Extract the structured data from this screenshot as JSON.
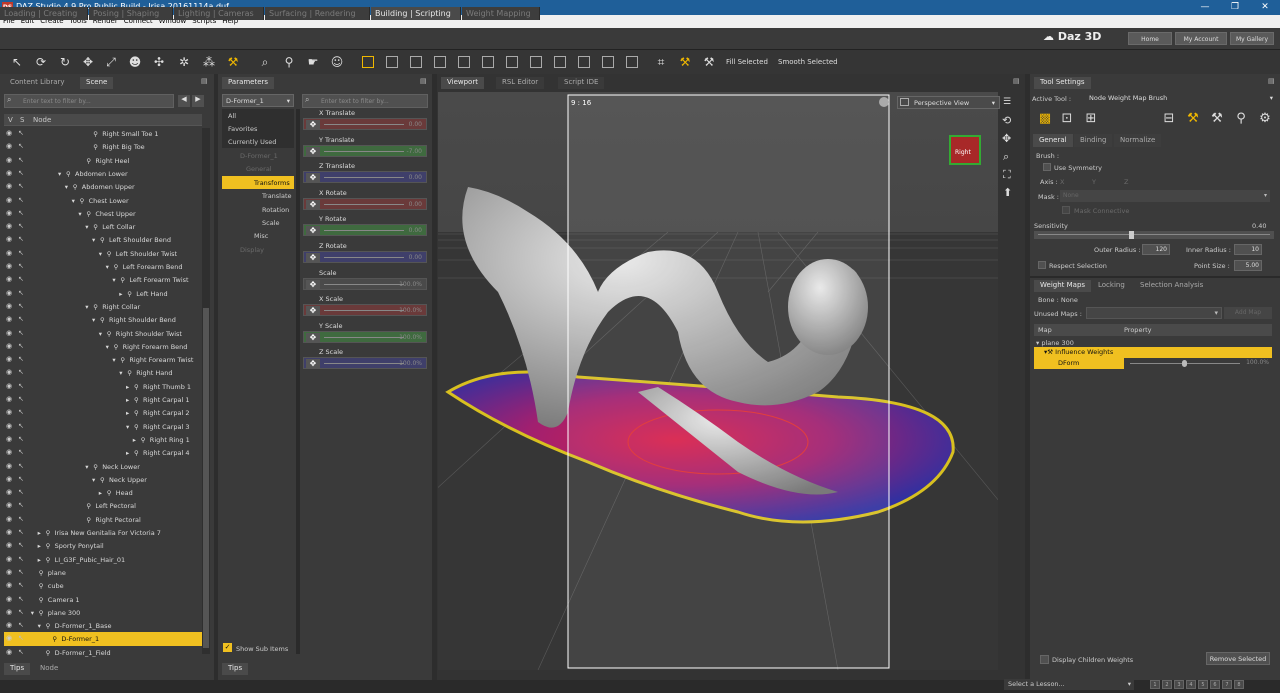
{
  "window": {
    "title": "DAZ Studio 4.9 Pro Public Build - Irisa 20161114a.duf",
    "icon": "DS",
    "min": "—",
    "max": "❐",
    "close": "✕"
  },
  "menu": [
    "File",
    "Edit",
    "Create",
    "Tools",
    "Render",
    "Connect",
    "Window",
    "Scripts",
    "Help"
  ],
  "rooms": [
    "Loading | Creating",
    "Posing | Shaping",
    "Lighting | Cameras",
    "Surfacing | Rendering",
    "Building | Scripting",
    "Weight Mapping"
  ],
  "brand": "Daz 3D",
  "top_buttons": [
    "Home",
    "My Account",
    "My Gallery"
  ],
  "toolbar": {
    "fill_selected": "Fill Selected",
    "smooth_selected": "Smooth Selected"
  },
  "scene_panel": {
    "tabs": [
      "Content Library",
      "Scene"
    ],
    "filter_placeholder": "Enter text to filter by...",
    "cols": {
      "v": "V",
      "s": "S",
      "node": "Node"
    },
    "rows": [
      {
        "label": "Right Small Toe 1",
        "indent": 9,
        "arrow": "",
        "sel": false
      },
      {
        "label": "Right Big Toe",
        "indent": 9,
        "arrow": "",
        "sel": false
      },
      {
        "label": "Right Heel",
        "indent": 8,
        "arrow": "",
        "sel": false
      },
      {
        "label": "Abdomen Lower",
        "indent": 5,
        "arrow": "▾",
        "sel": false
      },
      {
        "label": "Abdomen Upper",
        "indent": 6,
        "arrow": "▾",
        "sel": false
      },
      {
        "label": "Chest Lower",
        "indent": 7,
        "arrow": "▾",
        "sel": false
      },
      {
        "label": "Chest Upper",
        "indent": 8,
        "arrow": "▾",
        "sel": false
      },
      {
        "label": "Left Collar",
        "indent": 9,
        "arrow": "▾",
        "sel": false
      },
      {
        "label": "Left Shoulder Bend",
        "indent": 10,
        "arrow": "▾",
        "sel": false
      },
      {
        "label": "Left Shoulder Twist",
        "indent": 11,
        "arrow": "▾",
        "sel": false
      },
      {
        "label": "Left Forearm Bend",
        "indent": 12,
        "arrow": "▾",
        "sel": false
      },
      {
        "label": "Left Forearm Twist",
        "indent": 13,
        "arrow": "▾",
        "sel": false
      },
      {
        "label": "Left Hand",
        "indent": 14,
        "arrow": "▸",
        "sel": false
      },
      {
        "label": "Right Collar",
        "indent": 9,
        "arrow": "▾",
        "sel": false
      },
      {
        "label": "Right Shoulder Bend",
        "indent": 10,
        "arrow": "▾",
        "sel": false
      },
      {
        "label": "Right Shoulder Twist",
        "indent": 11,
        "arrow": "▾",
        "sel": false
      },
      {
        "label": "Right Forearm Bend",
        "indent": 12,
        "arrow": "▾",
        "sel": false
      },
      {
        "label": "Right Forearm Twist",
        "indent": 13,
        "arrow": "▾",
        "sel": false
      },
      {
        "label": "Right Hand",
        "indent": 14,
        "arrow": "▾",
        "sel": false
      },
      {
        "label": "Right Thumb 1",
        "indent": 15,
        "arrow": "▸",
        "sel": false
      },
      {
        "label": "Right Carpal 1",
        "indent": 15,
        "arrow": "▸",
        "sel": false
      },
      {
        "label": "Right Carpal 2",
        "indent": 15,
        "arrow": "▸",
        "sel": false
      },
      {
        "label": "Right Carpal 3",
        "indent": 15,
        "arrow": "▾",
        "sel": false
      },
      {
        "label": "Right Ring 1",
        "indent": 16,
        "arrow": "▸",
        "sel": false
      },
      {
        "label": "Right Carpal 4",
        "indent": 15,
        "arrow": "▸",
        "sel": false
      },
      {
        "label": "Neck Lower",
        "indent": 9,
        "arrow": "▾",
        "sel": false
      },
      {
        "label": "Neck Upper",
        "indent": 10,
        "arrow": "▾",
        "sel": false
      },
      {
        "label": "Head",
        "indent": 11,
        "arrow": "▸",
        "sel": false
      },
      {
        "label": "Left Pectoral",
        "indent": 8,
        "arrow": "",
        "sel": false
      },
      {
        "label": "Right Pectoral",
        "indent": 8,
        "arrow": "",
        "sel": false
      },
      {
        "label": "Irisa New Genitalia For Victoria 7",
        "indent": 2,
        "arrow": "▸",
        "sel": false
      },
      {
        "label": "Sporty Ponytail",
        "indent": 2,
        "arrow": "▸",
        "sel": false
      },
      {
        "label": "LI_G3F_Pubic_Hair_01",
        "indent": 2,
        "arrow": "▸",
        "sel": false
      },
      {
        "label": "plane",
        "indent": 1,
        "arrow": "",
        "sel": false
      },
      {
        "label": "cube",
        "indent": 1,
        "arrow": "",
        "sel": false
      },
      {
        "label": "Camera 1",
        "indent": 1,
        "arrow": "",
        "sel": false
      },
      {
        "label": "plane 300",
        "indent": 1,
        "arrow": "▾",
        "sel": false
      },
      {
        "label": "D-Former_1_Base",
        "indent": 2,
        "arrow": "▾",
        "sel": false
      },
      {
        "label": "D-Former_1",
        "indent": 3,
        "arrow": "",
        "sel": true
      },
      {
        "label": "D-Former_1_Field",
        "indent": 2,
        "arrow": "",
        "sel": false
      }
    ],
    "bottom_tabs": [
      "Tips",
      "Node"
    ]
  },
  "params_panel": {
    "tab": "Parameters",
    "node_select": "D-Former_1",
    "filter_placeholder": "Enter text to filter by...",
    "groups": [
      "All",
      "Favorites",
      "Currently Used",
      "D-Former_1",
      "General",
      "Transforms",
      "Translate",
      "Rotation",
      "Scale",
      "Misc",
      "Display"
    ],
    "show_sub": "Show Sub Items",
    "bottom_tab": "Tips",
    "params": [
      {
        "name": "X Translate",
        "value": "0.00",
        "color": "#6a3a3a"
      },
      {
        "name": "Y Translate",
        "value": "-7.00",
        "color": "#3f6a3f"
      },
      {
        "name": "Z Translate",
        "value": "0.00",
        "color": "#3f3f6a"
      },
      {
        "name": "X Rotate",
        "value": "0.00",
        "color": "#6a3a3a"
      },
      {
        "name": "Y Rotate",
        "value": "0.00",
        "color": "#3f6a3f"
      },
      {
        "name": "Z Rotate",
        "value": "0.00",
        "color": "#3f3f6a"
      },
      {
        "name": "Scale",
        "value": "100.0%",
        "color": "#4a4a4a"
      },
      {
        "name": "X Scale",
        "value": "100.0%",
        "color": "#6a3a3a"
      },
      {
        "name": "Y Scale",
        "value": "100.0%",
        "color": "#3f6a3f"
      },
      {
        "name": "Z Scale",
        "value": "100.0%",
        "color": "#3f3f6a"
      }
    ]
  },
  "viewport": {
    "tabs": [
      "Viewport",
      "RSL Editor",
      "Script IDE"
    ],
    "aspect": "9 : 16",
    "view": "Perspective View",
    "cube_label": "Right"
  },
  "tool_settings": {
    "tab": "Tool Settings",
    "active_label": "Active Tool :",
    "active_tool": "Node Weight Map Brush",
    "subtabs": [
      "General",
      "Binding",
      "Normalize"
    ],
    "brush": "Brush :",
    "use_symmetry": "Use Symmetry",
    "axis": "Axis :",
    "axis_opts": [
      "X",
      "Y",
      "Z"
    ],
    "mask": "Mask :",
    "mask_value": "None",
    "mask_connective": "Mask Connective",
    "sensitivity": "Sensitivity",
    "sensitivity_val": "0.40",
    "outer_radius": "Outer Radius :",
    "outer_val": "120",
    "inner_radius": "Inner Radius :",
    "inner_val": "10",
    "respect": "Respect Selection",
    "point_size": "Point Size :",
    "point_val": "5.00",
    "wm_tabs": [
      "Weight Maps",
      "Locking",
      "Selection Analysis"
    ],
    "bone": "Bone : None",
    "unused": "Unused Maps :",
    "add_map": "Add Map",
    "col_map": "Map",
    "col_prop": "Property",
    "tree_root": "plane 300",
    "tree_inf": "Influence Weights",
    "tree_dform": "DForm",
    "tree_val": "100.0%",
    "display_children": "Display Children Weights",
    "remove_selected": "Remove Selected"
  },
  "status": {
    "lesson": "Select a Lesson...",
    "pages": [
      "1",
      "2",
      "3",
      "4",
      "5",
      "6",
      "7",
      "8"
    ]
  }
}
